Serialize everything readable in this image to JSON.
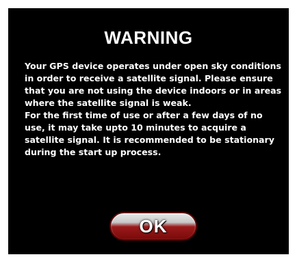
{
  "dialog": {
    "title": "WARNING",
    "paragraph_1": "Your GPS device operates under open sky conditions in order to receive a satellite signal. Please ensure that you are not using the device indoors or in areas where the satellite signal is weak.",
    "paragraph_2": "For the first time of use or after a few days of no use, it may take upto 10 minutes to acquire a satellite signal. It is recommended to be stationary during the start up process.",
    "ok_label": "OK"
  },
  "colors": {
    "background": "#000000",
    "text": "#ffffff",
    "button_accent": "#8b0000"
  }
}
